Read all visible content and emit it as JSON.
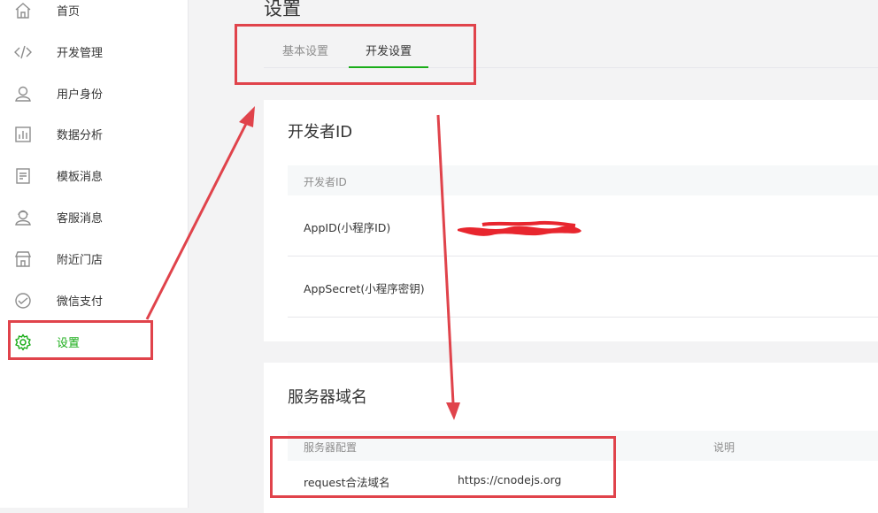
{
  "sidebar": {
    "items": [
      {
        "label": "首页",
        "icon": "home-icon"
      },
      {
        "label": "开发管理",
        "icon": "code-icon"
      },
      {
        "label": "用户身份",
        "icon": "user-icon"
      },
      {
        "label": "数据分析",
        "icon": "bar-chart-icon"
      },
      {
        "label": "模板消息",
        "icon": "document-icon"
      },
      {
        "label": "客服消息",
        "icon": "customer-service-icon"
      },
      {
        "label": "附近门店",
        "icon": "store-icon"
      },
      {
        "label": "微信支付",
        "icon": "payment-icon"
      },
      {
        "label": "设置",
        "icon": "gear-icon",
        "active": true
      }
    ]
  },
  "main": {
    "title": "设置",
    "tabs": [
      {
        "label": "基本设置"
      },
      {
        "label": "开发设置",
        "active": true
      }
    ],
    "developer_card": {
      "title": "开发者ID",
      "header": "开发者ID",
      "rows": [
        {
          "label": "AppID(小程序ID)",
          "value_redacted": true
        },
        {
          "label": "AppSecret(小程序密钥)"
        }
      ]
    },
    "server_card": {
      "title": "服务器域名",
      "header_config": "服务器配置",
      "header_desc": "说明",
      "rows": [
        {
          "label": "request合法域名",
          "value": "https://cnodejs.org"
        }
      ]
    }
  },
  "colors": {
    "accent": "#1aad19",
    "annotation": "#e0434b"
  }
}
